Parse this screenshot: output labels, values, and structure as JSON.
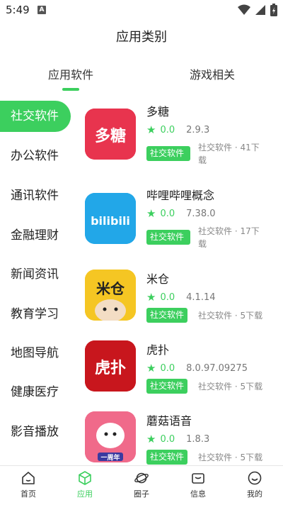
{
  "status": {
    "time": "5:49",
    "notification_badge": "A"
  },
  "header": {
    "title": "应用类别"
  },
  "tabs": [
    {
      "label": "应用软件",
      "active": true
    },
    {
      "label": "游戏相关",
      "active": false
    }
  ],
  "sidebar": {
    "items": [
      {
        "label": "社交软件",
        "active": true
      },
      {
        "label": "办公软件"
      },
      {
        "label": "通讯软件"
      },
      {
        "label": "金融理财"
      },
      {
        "label": "新闻资讯"
      },
      {
        "label": "教育学习"
      },
      {
        "label": "地图导航"
      },
      {
        "label": "健康医疗"
      },
      {
        "label": "影音播放"
      }
    ]
  },
  "apps": [
    {
      "name": "多糖",
      "score": "0.0",
      "version": "2.9.3",
      "tag": "社交软件",
      "meta_line1": "社交软件 · 41下",
      "meta_line2": "载",
      "icon_text": "多糖",
      "icon_color": "#e8344e"
    },
    {
      "name": "哔哩哔哩概念",
      "score": "0.0",
      "version": "7.38.0",
      "tag": "社交软件",
      "meta_line1": "社交软件 · 17下",
      "meta_line2": "载",
      "icon_text": "bilibili",
      "icon_color": "#22a7e8"
    },
    {
      "name": "米仓",
      "score": "0.0",
      "version": "4.1.14",
      "tag": "社交软件",
      "meta_line1": "社交软件 · 5下载",
      "meta_line2": "",
      "icon_text": "米仓",
      "icon_color": "#f5c623"
    },
    {
      "name": "虎扑",
      "score": "0.0",
      "version": "8.0.97.09275",
      "tag": "社交软件",
      "meta_line1": "社交软件 · 5下载",
      "meta_line2": "",
      "icon_text": "虎扑",
      "icon_color": "#c8161d"
    },
    {
      "name": "蘑菇语音",
      "score": "0.0",
      "version": "1.8.3",
      "tag": "社交软件",
      "meta_line1": "社交软件 · 5下载",
      "meta_line2": "",
      "icon_text": "一周年",
      "icon_color": "#f06a8a"
    }
  ],
  "bottom_nav": [
    {
      "label": "首页",
      "icon": "home-icon",
      "active": false
    },
    {
      "label": "应用",
      "icon": "cube-icon",
      "active": true
    },
    {
      "label": "圈子",
      "icon": "planet-icon",
      "active": false
    },
    {
      "label": "信息",
      "icon": "mail-icon",
      "active": false
    },
    {
      "label": "我的",
      "icon": "smile-icon",
      "active": false
    }
  ],
  "colors": {
    "accent": "#3ccf5e"
  }
}
